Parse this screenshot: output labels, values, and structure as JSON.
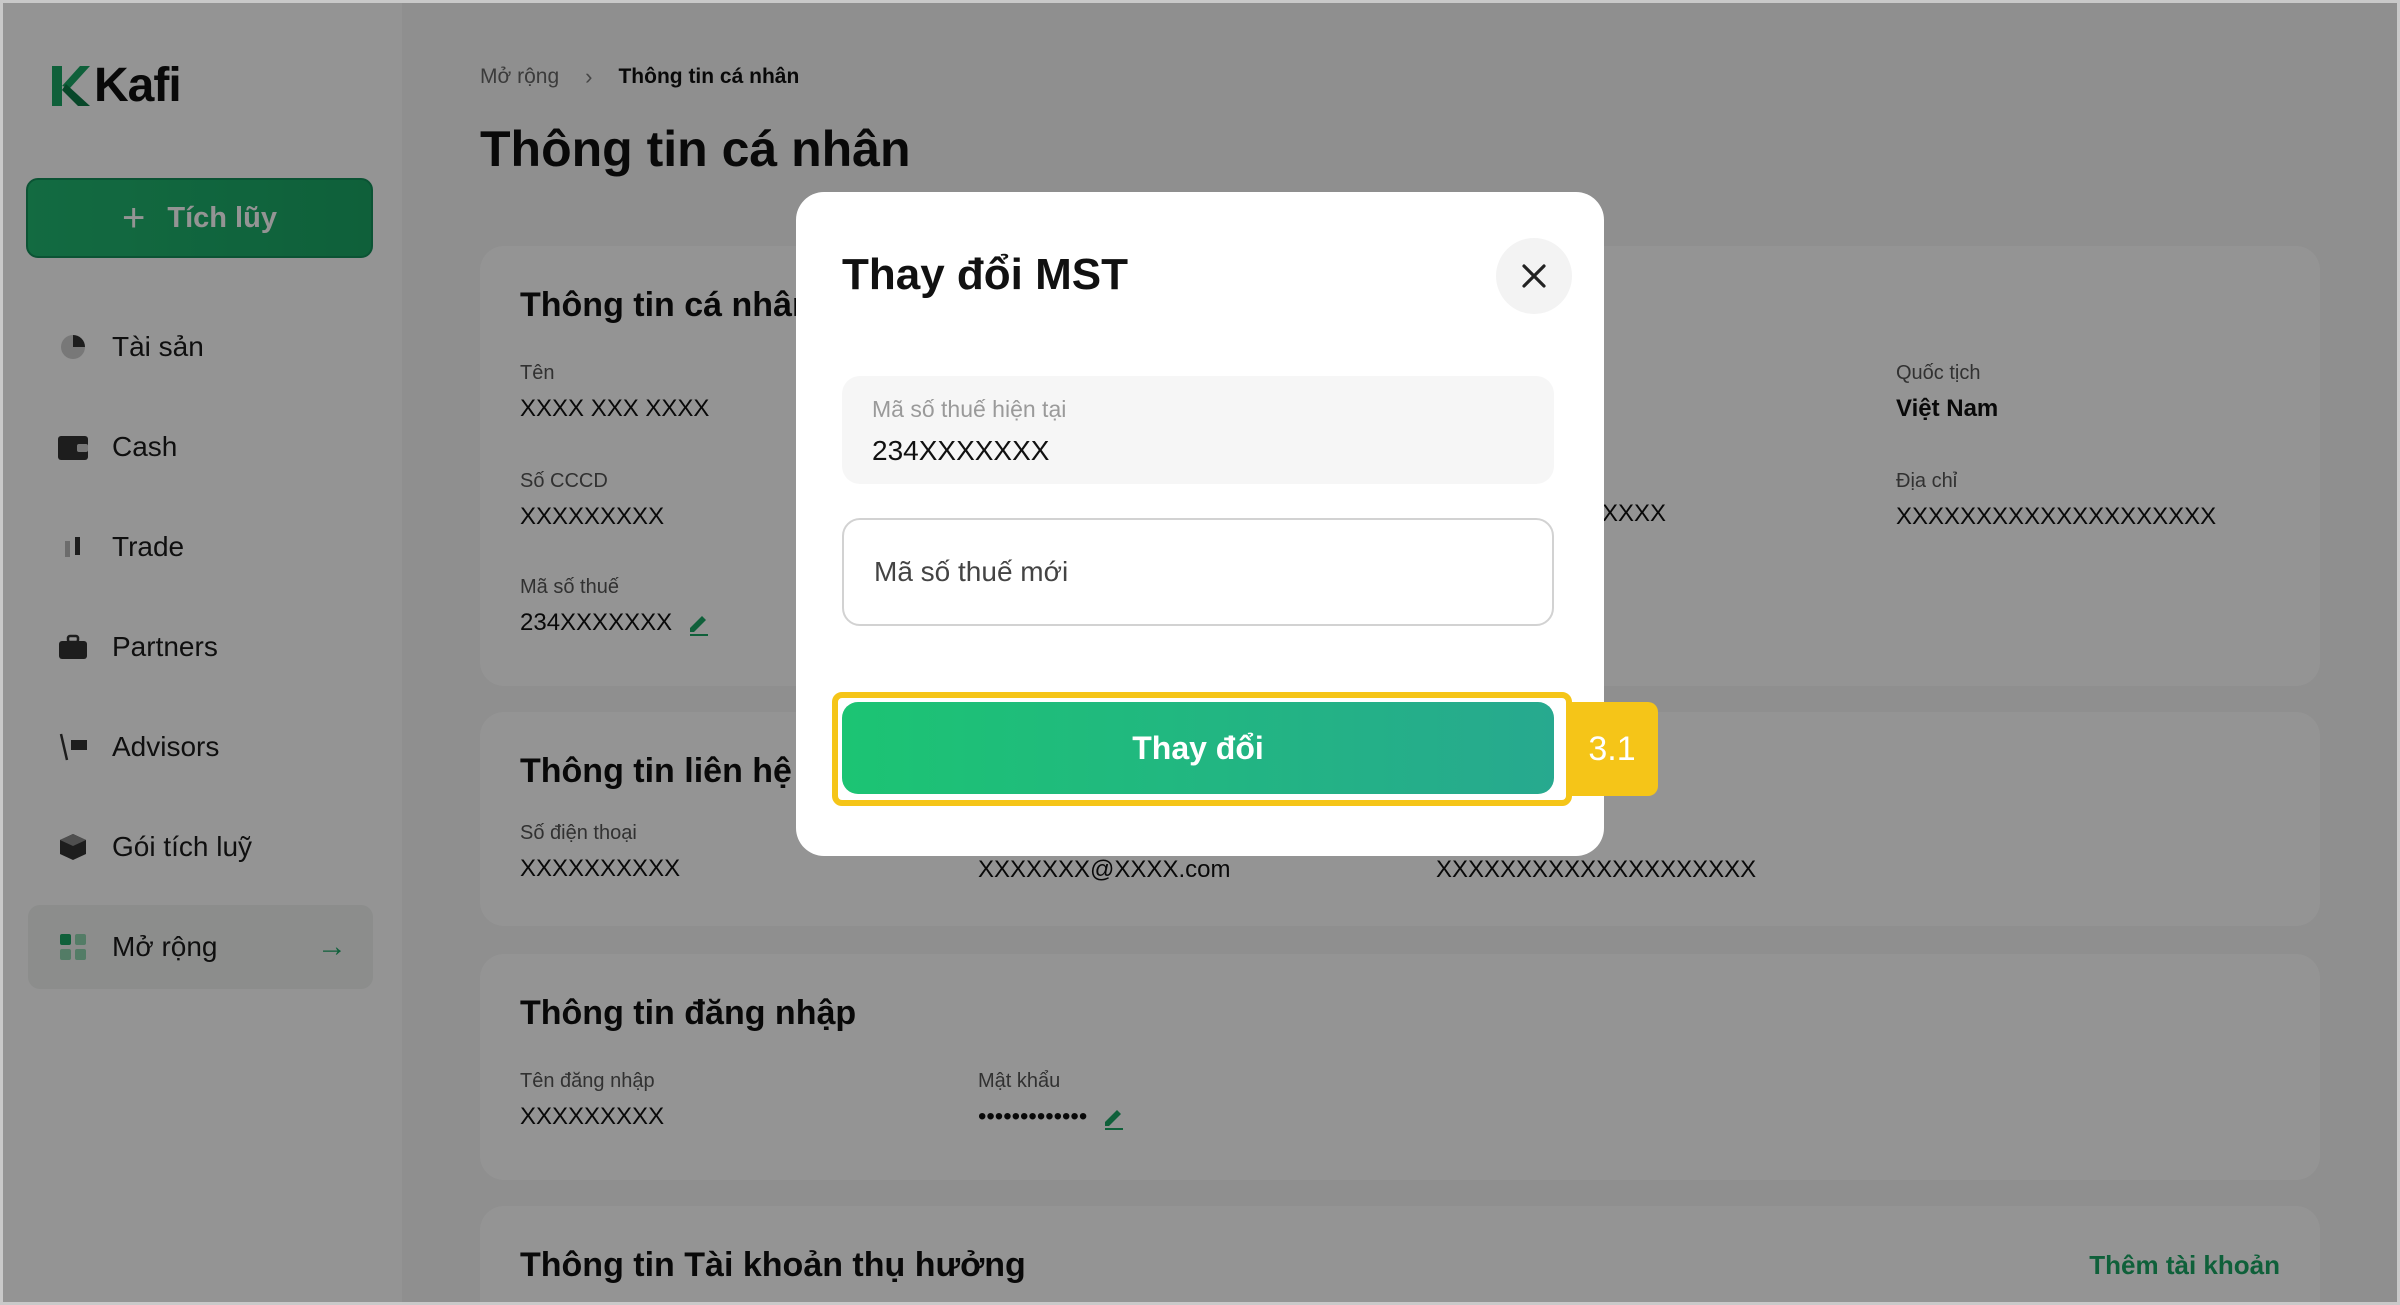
{
  "app": {
    "brand": "Kafi"
  },
  "sidebar": {
    "primary_button": {
      "icon": "plus-icon",
      "label": "Tích lũy"
    },
    "items": [
      {
        "label": "Tài sản",
        "icon": "pie-chart-icon"
      },
      {
        "label": "Cash",
        "icon": "wallet-icon"
      },
      {
        "label": "Trade",
        "icon": "candlestick-icon"
      },
      {
        "label": "Partners",
        "icon": "briefcase-icon"
      },
      {
        "label": "Advisors",
        "icon": "presentation-icon"
      },
      {
        "label": "Gói tích luỹ",
        "icon": "package-icon"
      },
      {
        "label": "Mở rộng",
        "icon": "grid-icon",
        "active": true,
        "trailing_icon": "arrow-right-icon"
      }
    ]
  },
  "breadcrumb": {
    "parent": "Mở rộng",
    "current": "Thông tin cá nhân"
  },
  "page_title": "Thông tin cá nhân",
  "personal_card": {
    "title": "Thông tin cá nhân",
    "name_label": "Tên",
    "name_value": "XXXX XXX XXXX",
    "id_label": "Số CCCD",
    "id_value": "XXXXXXXXX",
    "tax_label": "Mã số thuế",
    "tax_value": "234XXXXXXX",
    "partial_value": "XXXX",
    "nationality_label": "Quốc tịch",
    "nationality_value": "Việt Nam",
    "address_label": "Địa chỉ",
    "address_value": "XXXXXXXXXXXXXXXXXXXX"
  },
  "contact_card": {
    "title": "Thông tin liên hệ",
    "phone_label": "Số điện thoại",
    "phone_value": "XXXXXXXXXX",
    "email_value": "XXXXXXX@XXXX.com",
    "address_value": "XXXXXXXXXXXXXXXXXXXX"
  },
  "login_card": {
    "title": "Thông tin đăng nhập",
    "username_label": "Tên đăng nhập",
    "username_value": "XXXXXXXXX",
    "password_label": "Mật khẩu",
    "password_value": "•••••••••••••"
  },
  "beneficiary_card": {
    "title": "Thông tin Tài khoản thụ hưởng",
    "add_link": "Thêm tài khoản"
  },
  "modal": {
    "title": "Thay đổi MST",
    "current_tax_label": "Mã số thuế hiện tại",
    "current_tax_value": "234XXXXXXX",
    "new_tax_placeholder": "Mã số thuế mới",
    "submit_label": "Thay đổi"
  },
  "annotation": {
    "step_label": "3.1"
  },
  "colors": {
    "brand_green": "#1aa665",
    "highlight_yellow": "#f5c518"
  }
}
